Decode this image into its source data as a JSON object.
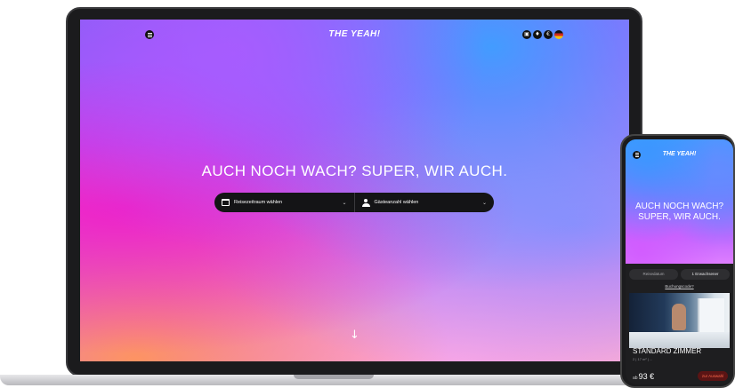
{
  "desktop": {
    "brand": "THE YEAH!",
    "hero_title": "AUCH NOCH WACH? SUPER, WIR AUCH.",
    "search": {
      "date_label": "Reisezeitraum wählen",
      "guests_label": "Gästeanzahl wählen",
      "chevron": "⌄"
    },
    "nav_icons": [
      "contact-icon",
      "location-icon",
      "currency-icon",
      "language-flag-icon"
    ],
    "currency_symbol": "€",
    "scroll_arrow": "↓"
  },
  "mobile": {
    "brand": "THE YEAH!",
    "hero_title": "AUCH NOCH WACH? SUPER, WIR AUCH.",
    "date_field": "Reisedatum",
    "guests_field": "1 Erwachsener",
    "booking_code_link": "Buchungscode?",
    "room": {
      "title": "STANDARD ZIMMER",
      "meta": "2  |  17 m²  |  ...",
      "price_prefix": "ab",
      "price": "93 €",
      "select_label": "zur Auswahl"
    }
  },
  "colors": {
    "accent_magenta": "#e23cf0",
    "accent_blue": "#3aa0ff",
    "dark_bar": "#141416",
    "select_button": "#5a1414"
  }
}
